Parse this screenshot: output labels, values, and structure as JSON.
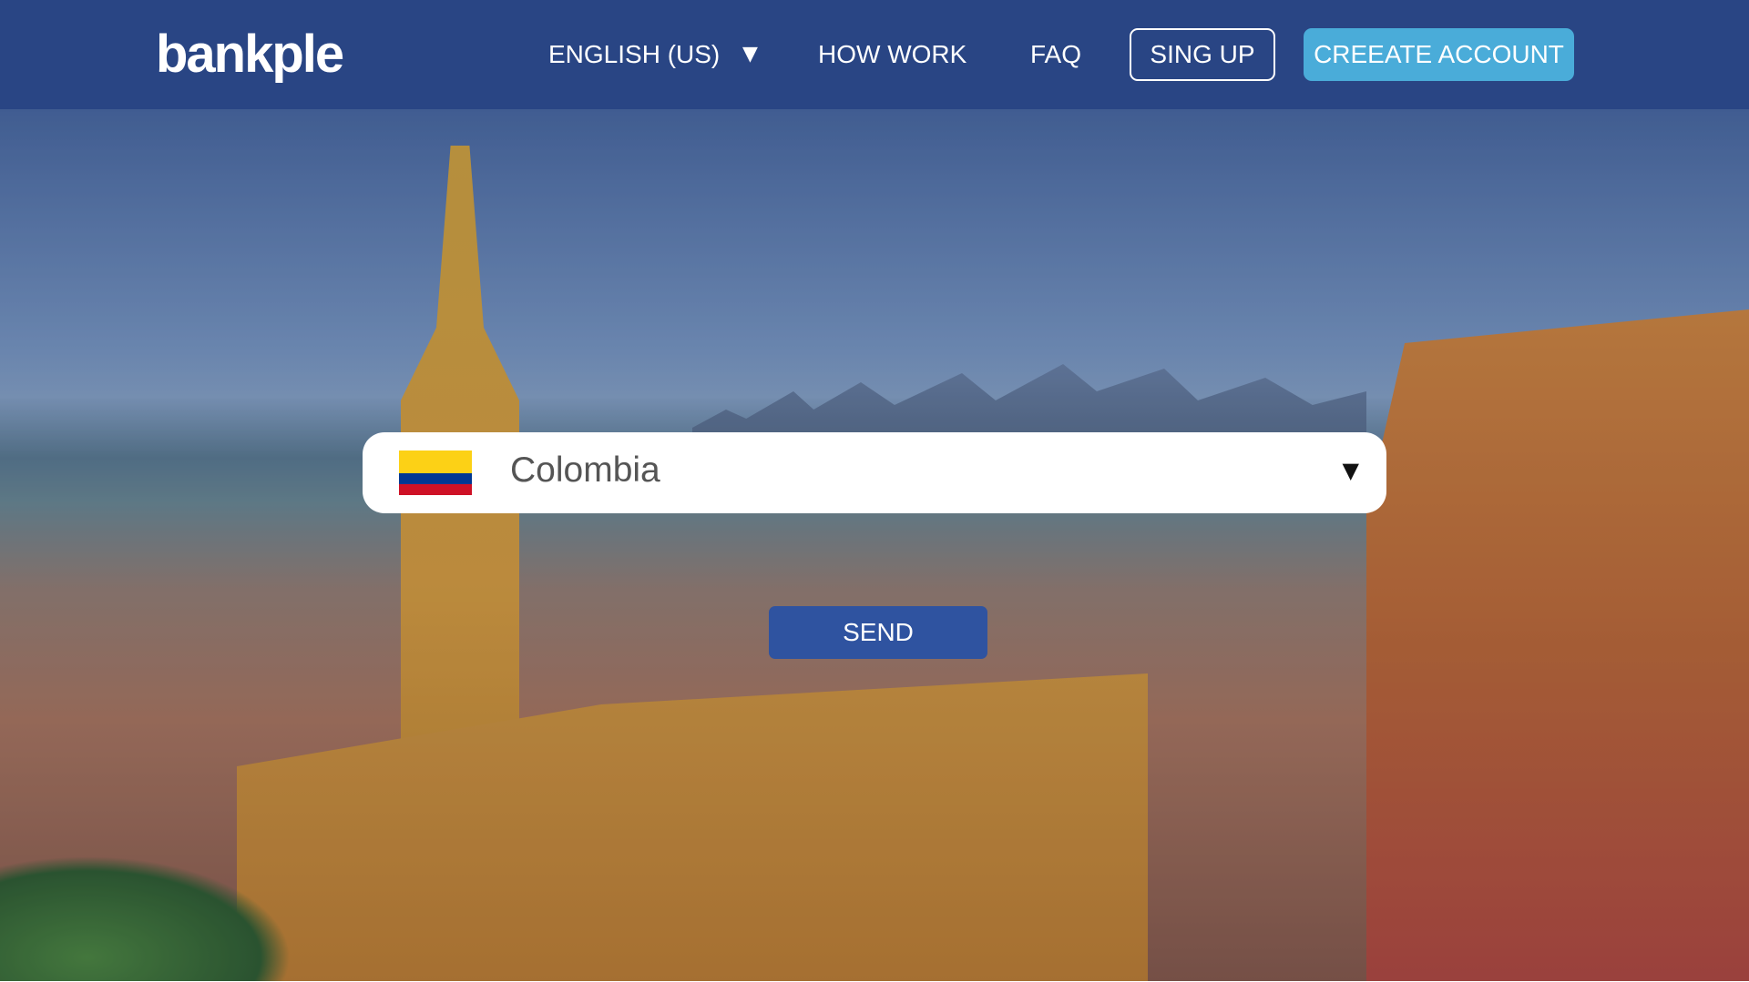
{
  "header": {
    "logo": "bankple",
    "language": "ENGLISH (US)",
    "language_caret": "▼",
    "how_work": "HOW WORK",
    "faq": "FAQ",
    "sign_up": "SING UP",
    "create_account": "CREEATE ACCOUNT"
  },
  "form": {
    "country": "Colombia",
    "caret": "▼",
    "flag_colors": [
      "#fcd116",
      "#003893",
      "#ce1126"
    ],
    "send": "SEND"
  }
}
